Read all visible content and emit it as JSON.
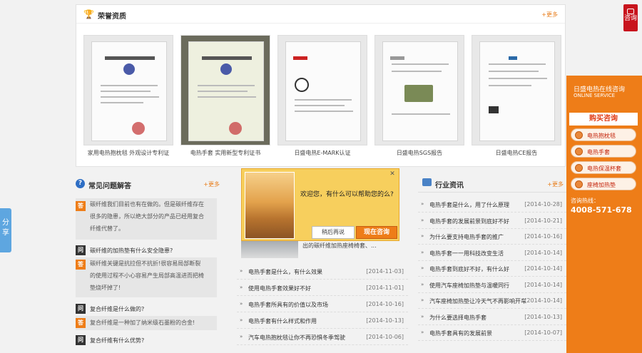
{
  "honor": {
    "title": "荣誉资质",
    "more": "+更多",
    "certs": [
      {
        "caption": "家用电热抱枕毯  外观设计专利证"
      },
      {
        "caption": "电热手套  实用新型专利证书"
      },
      {
        "caption": "日盛电热E-MARK认证"
      },
      {
        "caption": "日盛电热SGS报告"
      },
      {
        "caption": "日盛电热CE报告"
      }
    ]
  },
  "consult_tab": {
    "label": "咨询"
  },
  "service": {
    "title": "日盛电热在线咨询",
    "subtitle": "ONLINE SERVICE",
    "buy": "购买咨询",
    "items": [
      {
        "label": "电热抱枕毯"
      },
      {
        "label": "电热手套"
      },
      {
        "label": "电热保温杯套"
      },
      {
        "label": "座椅加热垫"
      }
    ],
    "hotline_label": "咨询热线：",
    "hotline": "4008-571-678"
  },
  "share": {
    "label": "分享"
  },
  "faq": {
    "title": "常见问题解答",
    "more": "+更多",
    "items": [
      {
        "a": [
          "碳纤维我们目前也有在做的。但是碳纤维存在",
          "很多的隐患，所以绝大部分的产品已经用复合",
          "纤维代替了。"
        ]
      },
      {
        "q": "碳纤维的加热垫有什么安全隐患?",
        "a": [
          "碳纤维关键是抗拉但不抗折!很容易局部断裂",
          "的使用过程不小心容易产生局部高温进而把椅",
          "垫烧坏掉了!"
        ]
      },
      {
        "q": "复合纤维是什么做的?",
        "a": [
          "复合纤维是一种加了纳米级石墨粉的合金!"
        ]
      },
      {
        "q": "复合纤维有什么优势?"
      }
    ]
  },
  "popup": {
    "greeting": "欢迎您，有什么可以帮助您的么?",
    "later": "稍后再说",
    "now": "现在咨询",
    "close": "✕"
  },
  "mid_news": {
    "brief": "出的碳纤维加热座椅椅套、...",
    "items": [
      {
        "title": "电热手套是什么，有什么效果",
        "date": "[2014-11-03]"
      },
      {
        "title": "使用电热手套效果好不好",
        "date": "[2014-11-01]"
      },
      {
        "title": "电热手套所具有的价值以及市场",
        "date": "[2014-10-16]"
      },
      {
        "title": "电热手套有什么样式和作用",
        "date": "[2014-10-13]"
      },
      {
        "title": "汽车电热抱枕毯让你不再恐惧冬季驾驶",
        "date": "[2014-10-06]"
      }
    ]
  },
  "industry": {
    "title": "行业资讯",
    "more": "+更多",
    "items": [
      {
        "title": "电热手套是什么，用了什么原理",
        "date": "[2014-10-28]"
      },
      {
        "title": "电热手套的发展前景到底好不好",
        "date": "[2014-10-21]"
      },
      {
        "title": "为什么要支持电热手套的推广",
        "date": "[2014-10-16]"
      },
      {
        "title": "电热手套一一用科技改变生活",
        "date": "[2014-10-14]"
      },
      {
        "title": "电热手套到底好不好，有什么好",
        "date": "[2014-10-14]"
      },
      {
        "title": "使用汽车座椅加热垫与温暖同行",
        "date": "[2014-10-14]"
      },
      {
        "title": "汽车座椅加热垫让冷天气不再影响开车",
        "date": "[2014-10-14]"
      },
      {
        "title": "为什么要选择电热手套",
        "date": "[2014-10-13]"
      },
      {
        "title": "电热手套具有的发展前景",
        "date": "[2014-10-07]"
      }
    ]
  }
}
